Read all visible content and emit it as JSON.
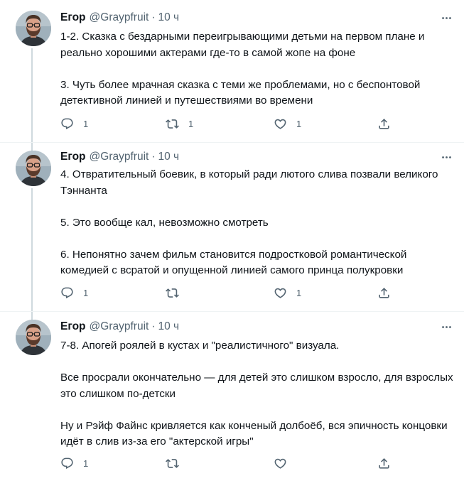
{
  "author": {
    "name": "Егор",
    "handle": "@Graypfruit",
    "separator": "·"
  },
  "tweets": [
    {
      "time": "10 ч",
      "paragraphs": [
        "1-2. Сказка с бездарными переигрывающими детьми на первом плане и реально хорошими актерами где-то в самой жопе на фоне",
        "3. Чуть более мрачная сказка с теми же проблемами, но с беспонтовой детективной линией и путешествиями во времени"
      ],
      "counts": {
        "reply": "1",
        "retweet": "1",
        "like": "1"
      }
    },
    {
      "time": "10 ч",
      "paragraphs": [
        "4. Отвратительный боевик, в который ради лютого слива позвали великого Тэннанта",
        "5. Это вообще кал, невозможно смотреть",
        "6. Непонятно зачем фильм становится подростковой романтической комедией с всратой и опущенной линией самого принца полукровки"
      ],
      "counts": {
        "reply": "1",
        "retweet": "",
        "like": "1"
      }
    },
    {
      "time": "10 ч",
      "paragraphs": [
        "7-8. Апогей роялей в кустах и \"реалистичного\" визуала.",
        "Все просрали окончательно — для детей это слишком взросло, для взрослых это слишком по-детски",
        "Ну и Рэйф Файнс кривляется как конченый долбоёб, вся эпичность концовки идёт в слив из-за его \"актерской игры\""
      ],
      "counts": {
        "reply": "1",
        "retweet": "",
        "like": ""
      }
    }
  ],
  "icons": {
    "more": "more-horizontal-icon",
    "reply": "reply-icon",
    "retweet": "retweet-icon",
    "like": "heart-icon",
    "share": "share-icon"
  },
  "colors": {
    "text": "#0f1419",
    "secondary": "#536471",
    "thread_line": "#cfd9de",
    "separator": "#eff3f4"
  }
}
